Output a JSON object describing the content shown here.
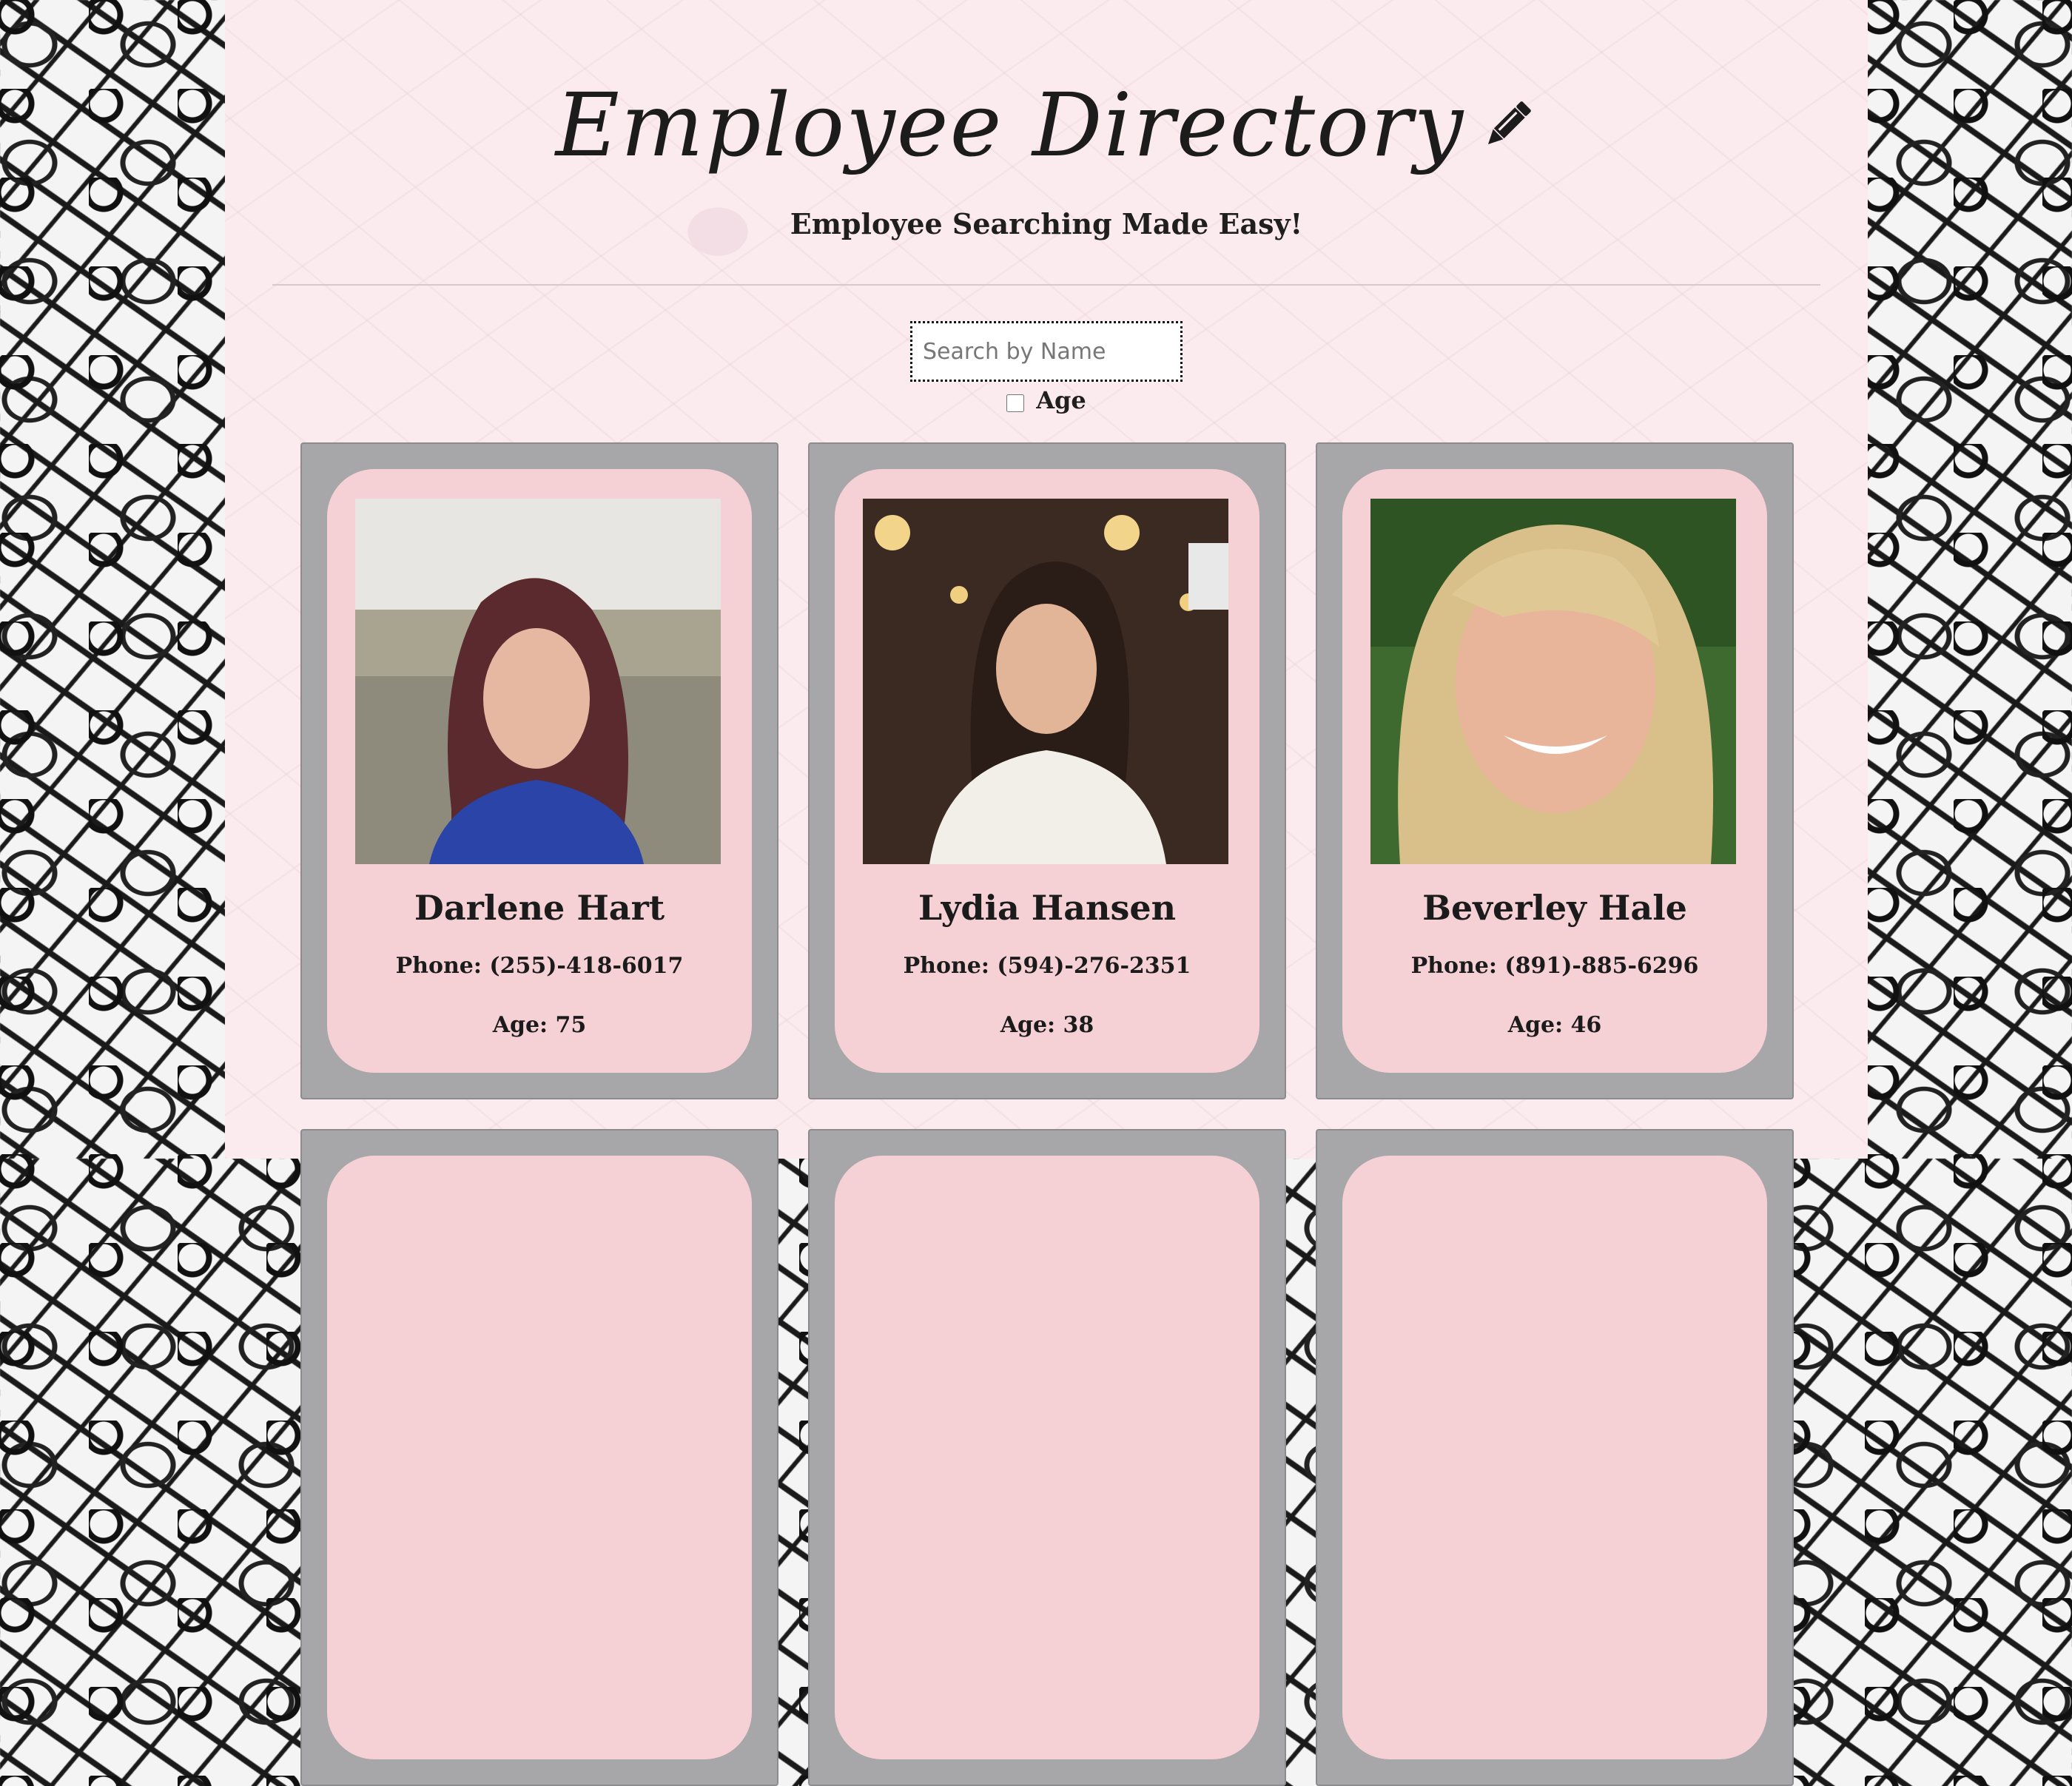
{
  "header": {
    "title": "Employee Directory",
    "title_icon": "pencil-icon",
    "subtitle": "Employee Searching Made Easy!"
  },
  "search": {
    "placeholder": "Search by Name",
    "value": ""
  },
  "filter": {
    "age_label": "Age",
    "age_checked": false
  },
  "employees": [
    {
      "name": "Darlene Hart",
      "phone_text": "Phone: (255)-418-6017",
      "age_text": "Age: 75"
    },
    {
      "name": "Lydia Hansen",
      "phone_text": "Phone: (594)-276-2351",
      "age_text": "Age: 38"
    },
    {
      "name": "Beverley Hale",
      "phone_text": "Phone: (891)-885-6296",
      "age_text": "Age: 46"
    }
  ],
  "colors": {
    "panel_bg": "#fbeaee",
    "card_bg": "#f5d1d6",
    "card_frame": "#a7a7a9"
  }
}
